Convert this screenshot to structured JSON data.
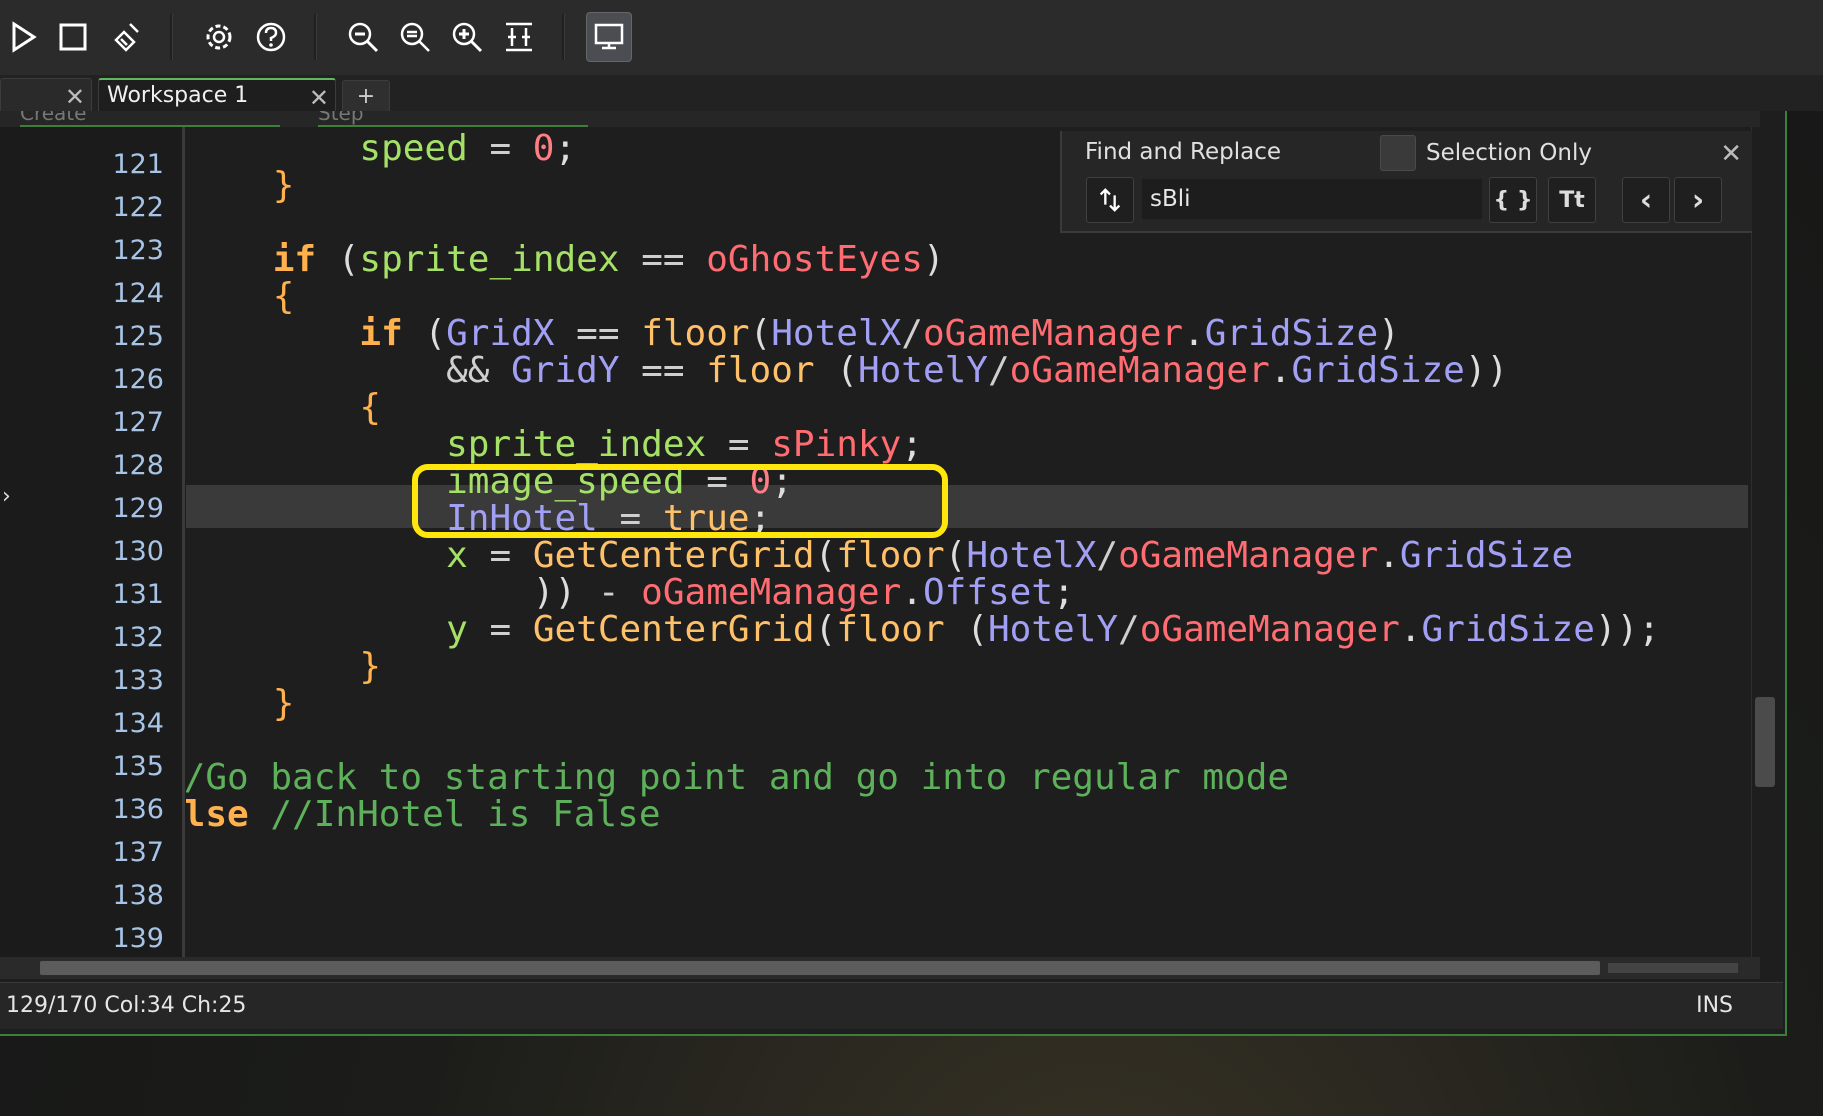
{
  "toolbar": {
    "buttons": [
      "play-icon",
      "stop-icon",
      "clean-icon",
      "settings-icon",
      "help-icon",
      "zoom-out-icon",
      "zoom-reset-icon",
      "zoom-in-icon",
      "fit-icon",
      "desktop-icon"
    ]
  },
  "tabs": {
    "active_label": "Workspace 1",
    "add_label": "+",
    "close_glyph": "✕"
  },
  "subtabs": [
    "Create",
    "Step"
  ],
  "find": {
    "title": "Find and Replace",
    "selection_only_label": "Selection Only",
    "query": "sBli",
    "regex_label": "{ }",
    "case_label": "Tt",
    "prev_label": "‹",
    "next_label": "›",
    "close_glyph": "✕"
  },
  "lines": [
    "121",
    "122",
    "123",
    "124",
    "125",
    "126",
    "127",
    "128",
    "129",
    "130",
    "131",
    "132",
    "133",
    "134",
    "135",
    "136",
    "137",
    "138",
    "139"
  ],
  "status": {
    "position": "129/170 Col:34 Ch:25",
    "mode": "INS"
  },
  "colors": {
    "keyword": "#ffb14e",
    "variable": "#a2a0f5",
    "builtin": "#a6e167",
    "resource": "#ff6d72",
    "comment": "#5db15a",
    "highlight_box": "#ffe70d"
  }
}
